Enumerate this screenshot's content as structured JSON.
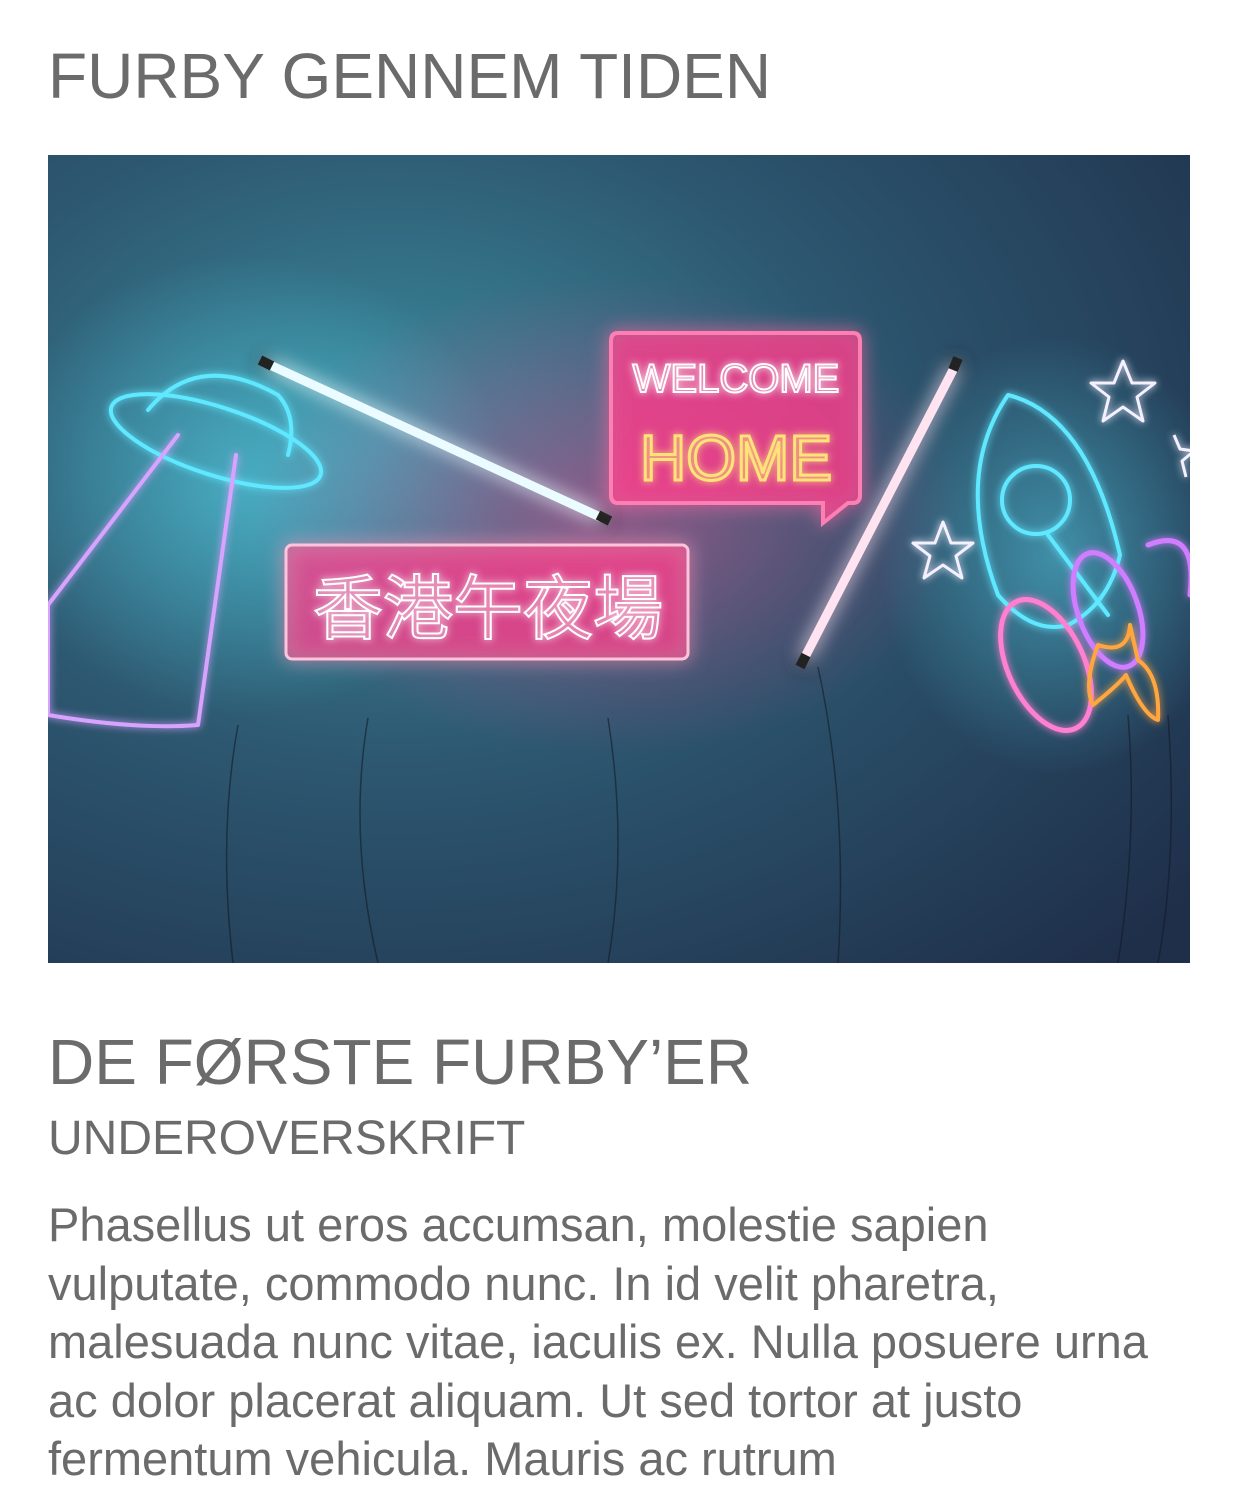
{
  "page": {
    "title": "FURBY GENNEM TIDEN"
  },
  "hero_image": {
    "sign_welcome": "WELCOME",
    "sign_home": "HOME",
    "sign_chinese": "香港午夜場",
    "colors": {
      "wall_dark": "#1f2f4a",
      "wall_glow": "#3a8c9e",
      "neon_pink": "#ff3d8b",
      "neon_cyan": "#5fe8ff",
      "neon_yellow": "#ffe27a",
      "neon_white": "#f4f0ff",
      "neon_orange": "#ffa640",
      "neon_violet": "#c78cff"
    }
  },
  "article": {
    "heading": "DE FØRSTE FURBY’ER",
    "subheading": "UNDEROVERSKRIFT",
    "body": "Phasellus ut eros accumsan, molestie sapien vulputate, commodo nunc. In id velit pharetra, malesuada nunc vitae, iaculis ex. Nulla posuere urna ac dolor placerat aliquam. Ut sed tortor at justo fermentum vehicula. Mauris ac rutrum"
  }
}
